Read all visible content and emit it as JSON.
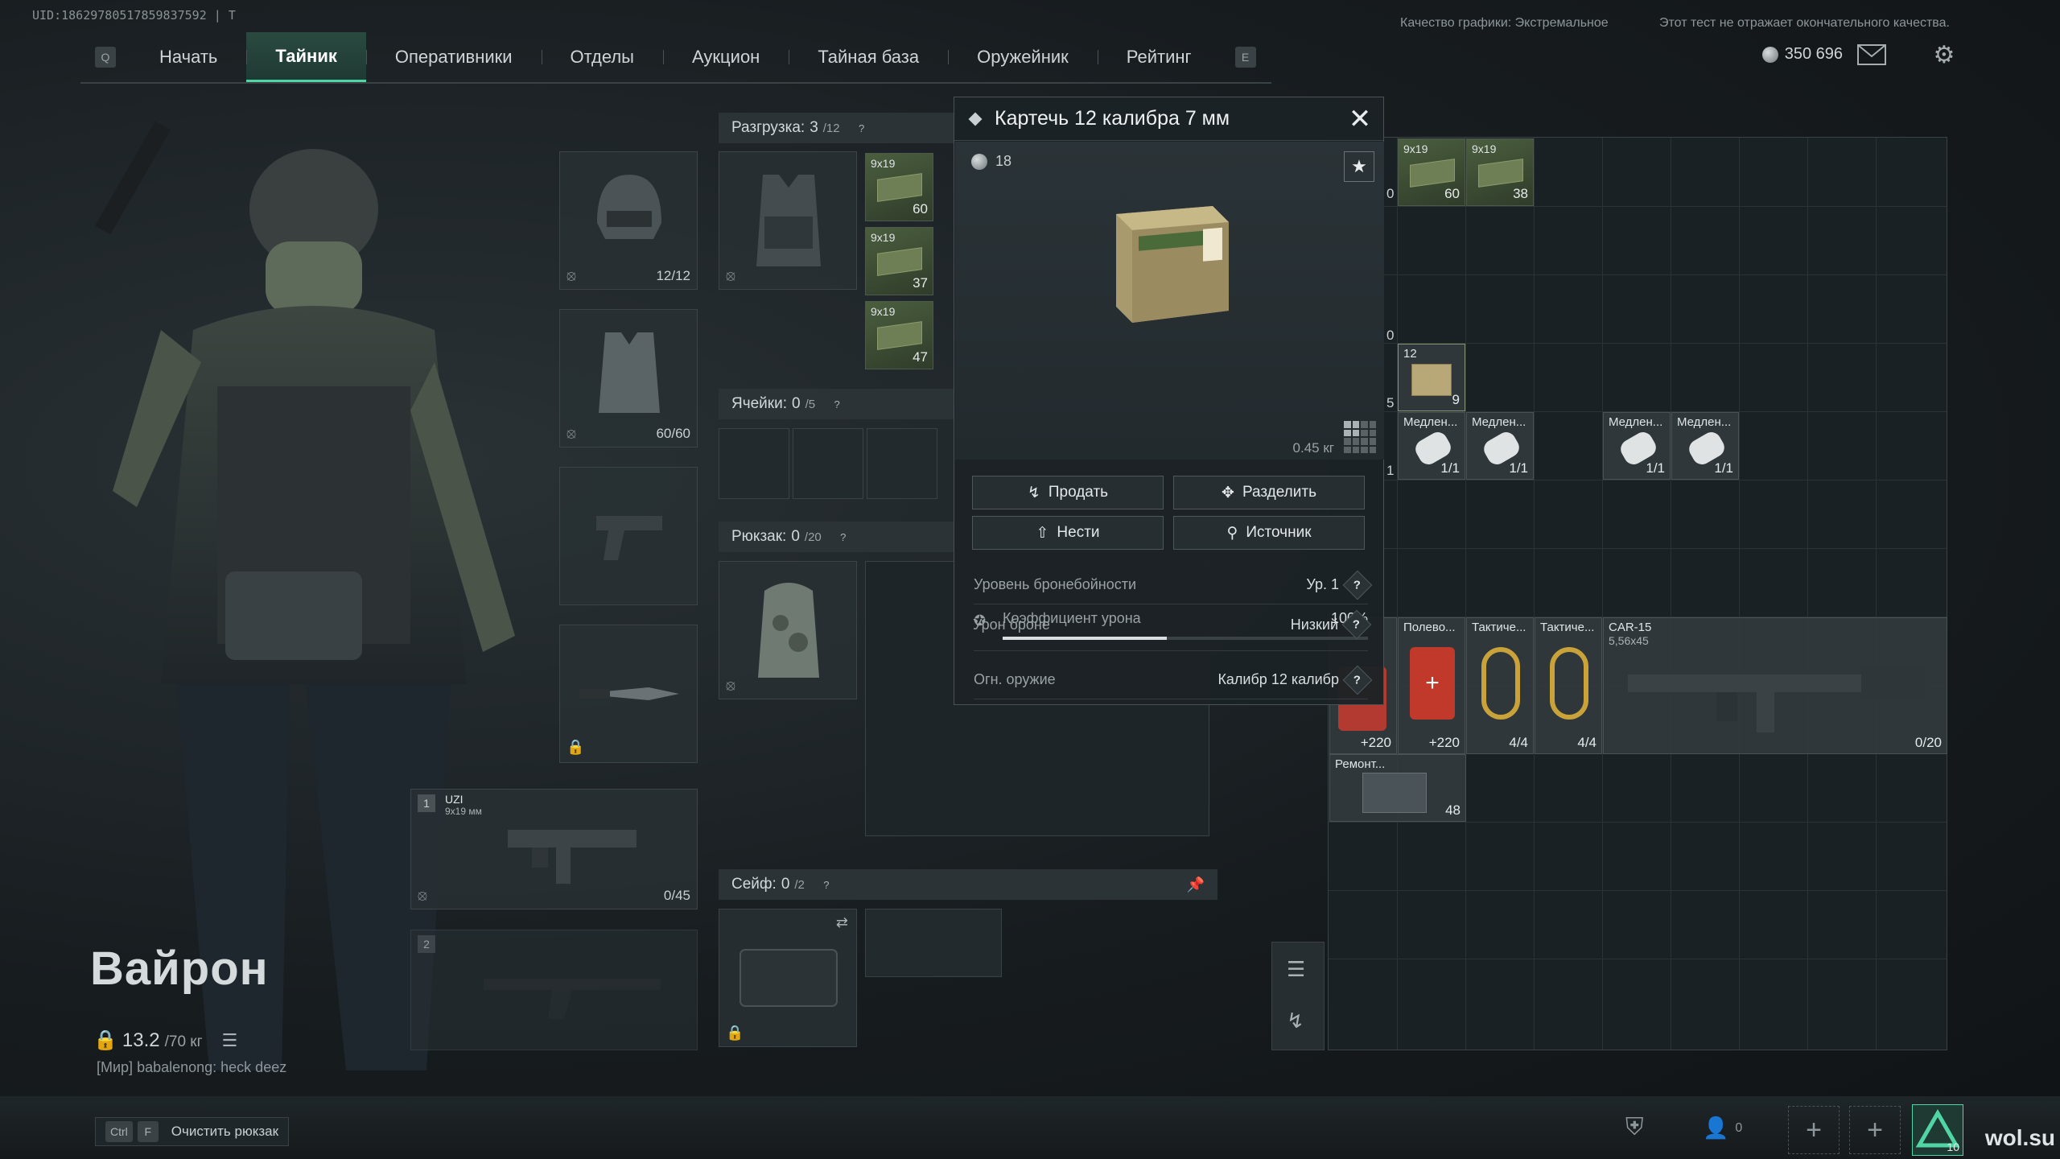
{
  "uid": "UID:18629780517859837592 | T",
  "graphics_quality": "Качество графики: Экстремальное",
  "disclaimer": "Этот тест не отражает окончательного качества.",
  "nav": {
    "left_key": "Q",
    "right_key": "E",
    "items": [
      "Начать",
      "Тайник",
      "Оперативники",
      "Отделы",
      "Аукцион",
      "Тайная база",
      "Оружейник",
      "Рейтинг"
    ],
    "active_index": 1
  },
  "currency": {
    "amount": "350 696"
  },
  "character": {
    "name": "Вайрон",
    "weight_current": "13.2",
    "weight_max": "/70 кг",
    "chat_line": "[Мир] babalenong: heck deez"
  },
  "equipment": {
    "helmet_count": "12/12",
    "armor_count": "60/60",
    "primary_slot_num": "1",
    "primary_name": "UZI",
    "primary_caliber": "9x19 мм",
    "primary_count": "0/45",
    "secondary_slot_num": "2"
  },
  "sections": {
    "rig_label": "Разгрузка:",
    "rig_value": "3",
    "rig_max": "/12",
    "pockets_label": "Ячейки:",
    "pockets_value": "0",
    "pockets_max": "/5",
    "backpack_label": "Рюкзак:",
    "backpack_value": "0",
    "backpack_max": "/20",
    "safe_label": "Сейф:",
    "safe_value": "0",
    "safe_max": "/2"
  },
  "rig_ammo": [
    {
      "label": "9x19",
      "count": "60"
    },
    {
      "label": "9x19",
      "count": "37"
    },
    {
      "label": "9x19",
      "count": "47"
    }
  ],
  "modal": {
    "title": "Картечь 12 калибра 7 мм",
    "price": "18",
    "weight": "0.45 кг",
    "buttons": {
      "sell": "Продать",
      "split": "Разделить",
      "carry": "Нести",
      "source": "Источник"
    },
    "stats": {
      "armor_pen_label": "Уровень бронебойности",
      "armor_pen_value": "Ур. 1",
      "damage_coef_label": "Коэффициент урона",
      "damage_coef_value": "100%",
      "weapon_label": "Огн. оружие",
      "weapon_value": "Калибр 12 калибр",
      "armor_dmg_label": "Урон броне",
      "armor_dmg_value": "Низкий"
    }
  },
  "stash": {
    "ammo_top": [
      {
        "label": "9x19",
        "count": "60"
      },
      {
        "label": "9x19",
        "count": "38"
      }
    ],
    "edge_counts": [
      "0",
      "0",
      "5",
      "1"
    ],
    "shot_item": {
      "label": "12",
      "count": "9"
    },
    "meds": [
      {
        "name": "Медлен...",
        "count": "1/1"
      },
      {
        "name": "Медлен...",
        "count": "1/1"
      },
      {
        "name": "Медлен...",
        "count": "1/1"
      },
      {
        "name": "Медлен...",
        "count": "1/1"
      }
    ],
    "kits": [
      {
        "name": "",
        "count": "+220"
      },
      {
        "name": "Полево...",
        "count": "+220"
      },
      {
        "name": "Тактиче...",
        "count": "4/4"
      },
      {
        "name": "Тактиче...",
        "count": "4/4"
      }
    ],
    "rifle": {
      "name": "CAR-15",
      "caliber": "5,56x45",
      "count": "0/20"
    },
    "repair": {
      "name": "Ремонт...",
      "count": "48"
    }
  },
  "bottom": {
    "key_ctrl": "Ctrl",
    "key_f": "F",
    "clear_backpack": "Очистить рюкзак",
    "friends_count": "0",
    "logo_count": "10",
    "site": "wol.su"
  }
}
